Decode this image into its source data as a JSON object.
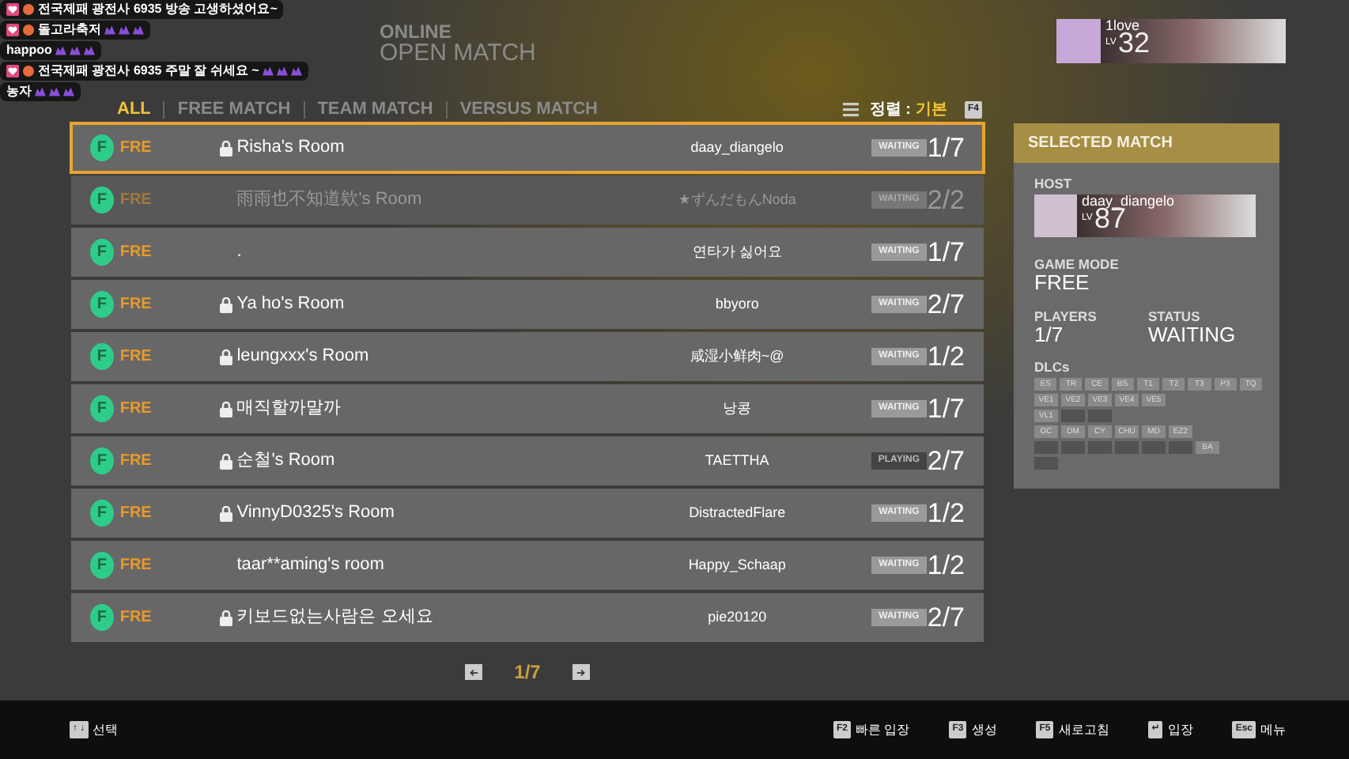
{
  "header": {
    "line1": "ONLINE",
    "line2": "OPEN MATCH"
  },
  "profile": {
    "name": "1love",
    "lv_label": "LV",
    "level": "32"
  },
  "tabs": [
    {
      "label": "ALL",
      "selected": true
    },
    {
      "label": "FREE MATCH",
      "selected": false
    },
    {
      "label": "TEAM MATCH",
      "selected": false
    },
    {
      "label": "VERSUS MATCH",
      "selected": false
    }
  ],
  "sort": {
    "label": "정렬 :",
    "value": "기본",
    "key": "F4"
  },
  "rooms": [
    {
      "mode_badge": "F",
      "mode": "FRE",
      "locked": true,
      "name": "Risha's Room",
      "host": "daay_diangelo",
      "status": "WAITING",
      "playing": false,
      "players": "1/7",
      "selected": true,
      "disabled": false
    },
    {
      "mode_badge": "F",
      "mode": "FRE",
      "locked": false,
      "name": "雨雨也不知道欸's Room",
      "host": "★ずんだもんNoda",
      "status": "WAITING",
      "playing": false,
      "players": "2/2",
      "selected": false,
      "disabled": true
    },
    {
      "mode_badge": "F",
      "mode": "FRE",
      "locked": false,
      "name": ".",
      "host": "연타가 싫어요",
      "status": "WAITING",
      "playing": false,
      "players": "1/7",
      "selected": false,
      "disabled": false
    },
    {
      "mode_badge": "F",
      "mode": "FRE",
      "locked": true,
      "name": "Ya ho's Room",
      "host": "bbyoro",
      "status": "WAITING",
      "playing": false,
      "players": "2/7",
      "selected": false,
      "disabled": false
    },
    {
      "mode_badge": "F",
      "mode": "FRE",
      "locked": true,
      "name": "leungxxx's Room",
      "host": "咸湿小鲜肉~@",
      "status": "WAITING",
      "playing": false,
      "players": "1/2",
      "selected": false,
      "disabled": false
    },
    {
      "mode_badge": "F",
      "mode": "FRE",
      "locked": true,
      "name": "매직할까말까",
      "host": "낭콩",
      "status": "WAITING",
      "playing": false,
      "players": "1/7",
      "selected": false,
      "disabled": false
    },
    {
      "mode_badge": "F",
      "mode": "FRE",
      "locked": true,
      "name": "순철's Room",
      "host": "TAETTHA",
      "status": "PLAYING",
      "playing": true,
      "players": "2/7",
      "selected": false,
      "disabled": false
    },
    {
      "mode_badge": "F",
      "mode": "FRE",
      "locked": true,
      "name": "VinnyD0325's Room",
      "host": "DistractedFlare",
      "status": "WAITING",
      "playing": false,
      "players": "1/2",
      "selected": false,
      "disabled": false
    },
    {
      "mode_badge": "F",
      "mode": "FRE",
      "locked": false,
      "name": "taar**aming's room",
      "host": "Happy_Schaap",
      "status": "WAITING",
      "playing": false,
      "players": "1/2",
      "selected": false,
      "disabled": false
    },
    {
      "mode_badge": "F",
      "mode": "FRE",
      "locked": true,
      "name": "키보드없는사람은 오세요",
      "host": "pie20120",
      "status": "WAITING",
      "playing": false,
      "players": "2/7",
      "selected": false,
      "disabled": false
    }
  ],
  "pagination": {
    "page": "1/7"
  },
  "selected_match": {
    "title": "SELECTED MATCH",
    "host_label": "HOST",
    "host_name": "daay_diangelo",
    "host_lv_label": "LV",
    "host_level": "87",
    "game_mode_label": "GAME MODE",
    "game_mode": "FREE",
    "players_label": "PLAYERS",
    "players": "1/7",
    "status_label": "STATUS",
    "status": "WAITING",
    "dlcs_label": "DLCs",
    "dlc_rows": [
      [
        {
          "label": "ES",
          "owned": true
        },
        {
          "label": "TR",
          "owned": true
        },
        {
          "label": "CE",
          "owned": true
        },
        {
          "label": "BS",
          "owned": true
        },
        {
          "label": "T1",
          "owned": true
        },
        {
          "label": "T2",
          "owned": true
        },
        {
          "label": "T3",
          "owned": true
        },
        {
          "label": "P3",
          "owned": true
        },
        {
          "label": "TQ",
          "owned": true
        }
      ],
      [
        {
          "label": "VE1",
          "owned": true
        },
        {
          "label": "VE2",
          "owned": true
        },
        {
          "label": "VE3",
          "owned": true
        },
        {
          "label": "VE4",
          "owned": true
        },
        {
          "label": "VE5",
          "owned": true
        }
      ],
      [
        {
          "label": "VL1",
          "owned": true
        },
        {
          "owned": false
        },
        {
          "owned": false
        }
      ],
      [
        {
          "label": "GC",
          "owned": true
        },
        {
          "label": "DM",
          "owned": true
        },
        {
          "label": "CY",
          "owned": true
        },
        {
          "label": "CHU",
          "owned": true
        },
        {
          "label": "MD",
          "owned": true
        },
        {
          "label": "EZ2",
          "owned": true
        }
      ],
      [
        {
          "owned": false
        },
        {
          "owned": false
        },
        {
          "owned": false
        },
        {
          "owned": false
        },
        {
          "owned": false
        },
        {
          "owned": false
        },
        {
          "label": "BA",
          "owned": true
        }
      ],
      [
        {
          "owned": false
        }
      ]
    ]
  },
  "footer": [
    {
      "key": "↑ ↓",
      "label": "선택"
    },
    {
      "key": "F2",
      "label": "빠른 입장"
    },
    {
      "key": "F3",
      "label": "생성"
    },
    {
      "key": "F5",
      "label": "새로고침"
    },
    {
      "key": "↵",
      "label": "입장"
    },
    {
      "key": "Esc",
      "label": "메뉴"
    }
  ],
  "chat": [
    {
      "text": "전국제패 광전사 6935 방송 고생하셨어요~",
      "badges": true,
      "emotes": false
    },
    {
      "text": "돌고라축저",
      "badges": true,
      "emotes": true
    },
    {
      "text": "happoo",
      "badges": false,
      "emotes": true
    },
    {
      "text": "전국제패 광전사 6935 주말 잘 쉬세요 ~",
      "badges": true,
      "emotes": true
    },
    {
      "text": "농자",
      "badges": false,
      "emotes": true
    }
  ]
}
